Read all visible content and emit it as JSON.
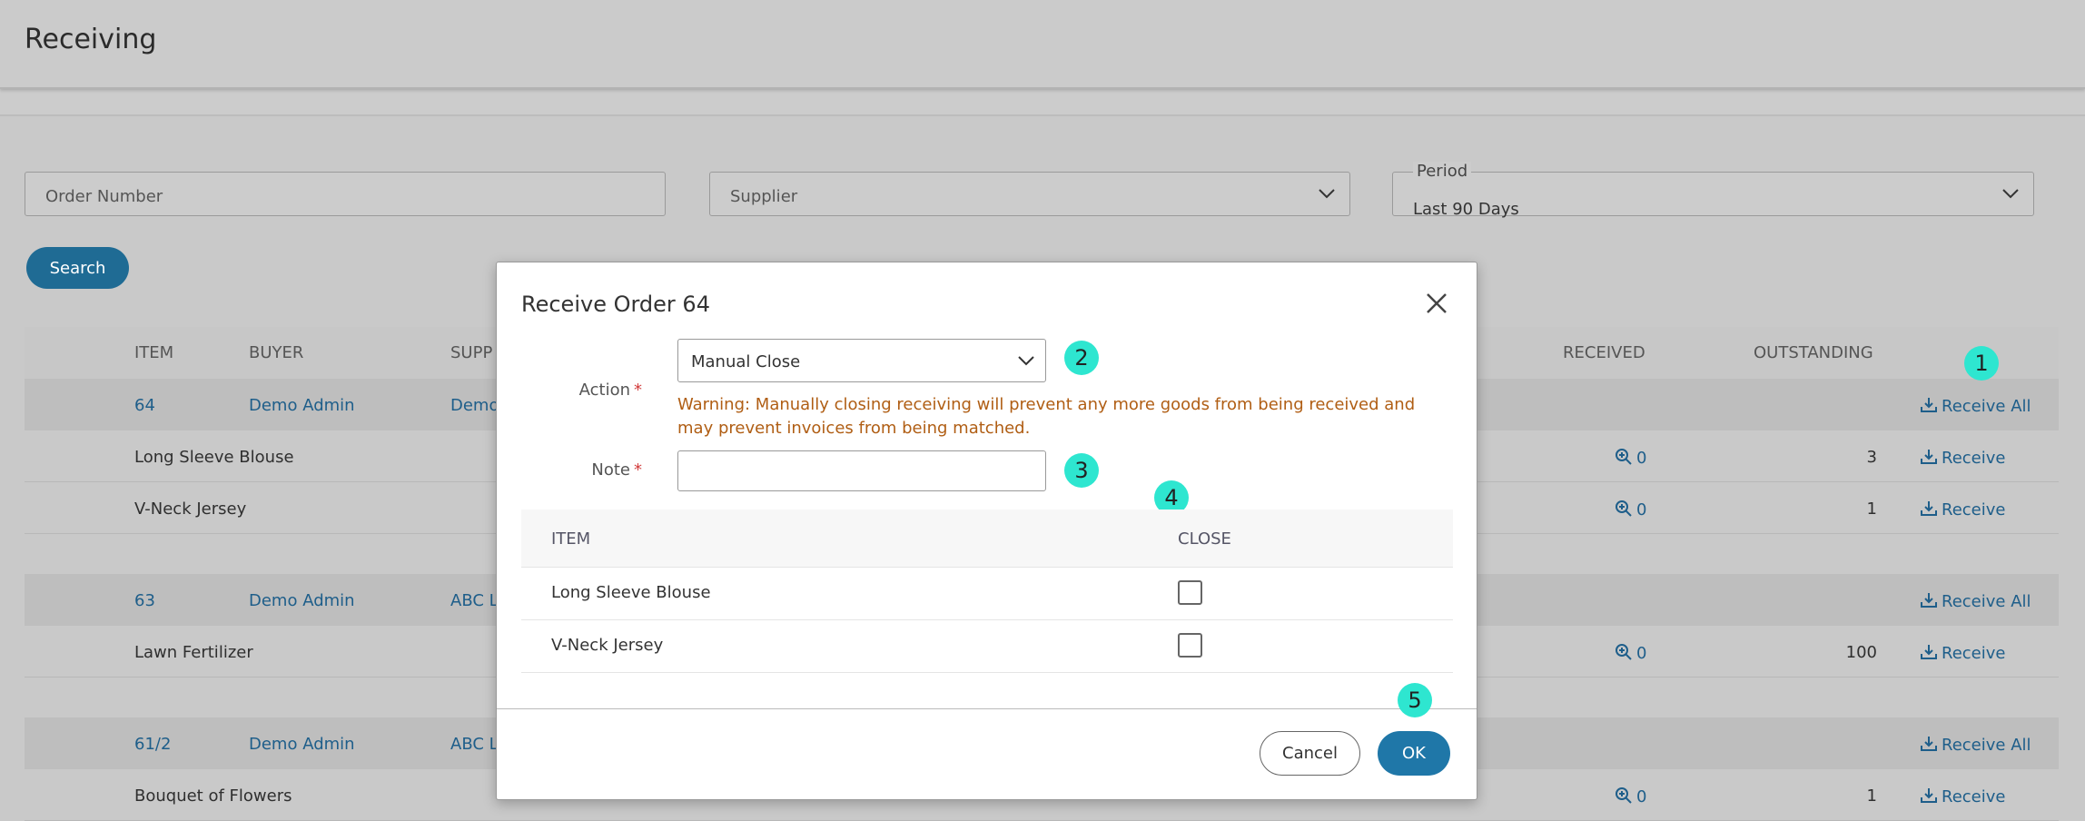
{
  "page": {
    "title": "Receiving"
  },
  "filters": {
    "order_number_placeholder": "Order Number",
    "supplier_placeholder": "Supplier",
    "period_label": "Period",
    "period_value": "Last 90 Days",
    "search_label": "Search"
  },
  "table": {
    "columns": [
      "ITEM",
      "BUYER",
      "SUPP",
      "RECEIVED",
      "OUTSTANDING"
    ],
    "orders": [
      {
        "order": "64",
        "buyer": "Demo Admin",
        "supplier": "Demo",
        "action": "Receive All",
        "items": [
          {
            "name": "Long Sleeve Blouse",
            "received": "0",
            "outstanding": "3",
            "action": "Receive"
          },
          {
            "name": "V-Neck Jersey",
            "received": "0",
            "outstanding": "1",
            "action": "Receive"
          }
        ]
      },
      {
        "order": "63",
        "buyer": "Demo Admin",
        "supplier": "ABC L",
        "action": "Receive All",
        "items": [
          {
            "name": "Lawn Fertilizer",
            "received": "0",
            "outstanding": "100",
            "action": "Receive"
          }
        ]
      },
      {
        "order": "61/2",
        "buyer": "Demo Admin",
        "supplier": "ABC L",
        "action": "Receive All",
        "items": [
          {
            "name": "Bouquet of Flowers",
            "received": "0",
            "outstanding": "1",
            "action": "Receive"
          }
        ]
      }
    ]
  },
  "modal": {
    "title": "Receive Order 64",
    "action_label": "Action",
    "required_mark": "*",
    "action_value": "Manual Close",
    "warning": "Warning: Manually closing receiving will prevent any more goods from being received and may prevent invoices from being matched.",
    "note_label": "Note",
    "columns": {
      "item": "ITEM",
      "close": "CLOSE"
    },
    "items": [
      {
        "name": "Long Sleeve Blouse",
        "close": false
      },
      {
        "name": "V-Neck Jersey",
        "close": false
      }
    ],
    "cancel_label": "Cancel",
    "ok_label": "OK"
  },
  "badges": [
    "1",
    "2",
    "3",
    "4",
    "5"
  ],
  "colors": {
    "accent": "#1f6b94",
    "link": "#1e5e8a",
    "warning": "#b05e14",
    "badge": "#2ee6d0"
  }
}
